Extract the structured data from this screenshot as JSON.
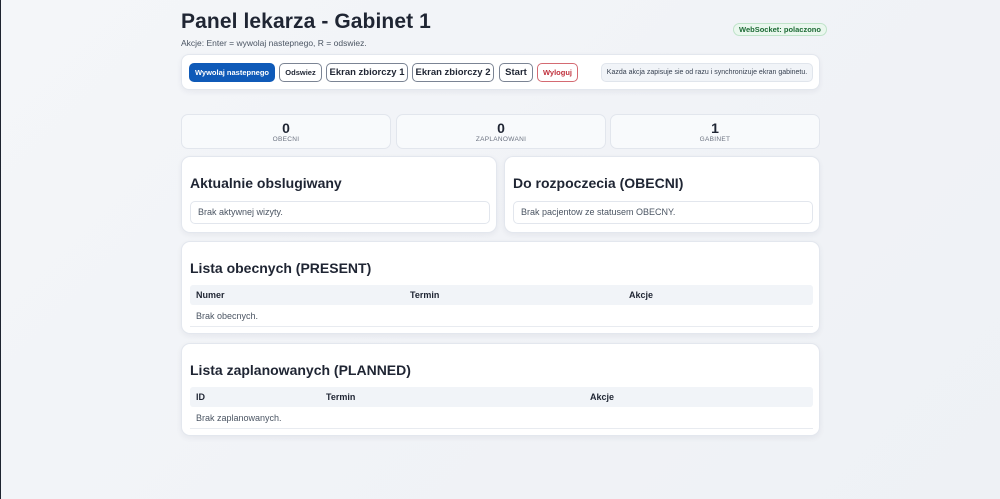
{
  "header": {
    "title": "Panel lekarza - Gabinet 1",
    "hint": "Akcje: Enter = wywolaj nastepnego, R = odswiez.",
    "ws_status": "WebSocket: polaczono"
  },
  "toolbar": {
    "call_next": "Wywolaj nastepnego",
    "refresh": "Odswiez",
    "screen1": "Ekran zbiorczy 1",
    "screen2": "Ekran zbiorczy 2",
    "start": "Start",
    "logout": "Wyloguj",
    "note": "Kazda akcja zapisuje sie od razu i synchronizuje ekran gabinetu."
  },
  "stats": [
    {
      "value": "0",
      "label": "OBECNI"
    },
    {
      "value": "0",
      "label": "ZAPLANOWANI"
    },
    {
      "value": "1",
      "label": "GABINET"
    }
  ],
  "current": {
    "title": "Aktualnie obslugiwany",
    "empty": "Brak aktywnej wizyty."
  },
  "queue": {
    "title": "Do rozpoczecia (OBECNI)",
    "empty": "Brak pacjentow ze statusem OBECNY."
  },
  "present_list": {
    "title": "Lista obecnych (PRESENT)",
    "columns": [
      "Numer",
      "Termin",
      "Akcje"
    ],
    "empty": "Brak obecnych."
  },
  "planned_list": {
    "title": "Lista zaplanowanych (PLANNED)",
    "columns": [
      "ID",
      "Termin",
      "Akcje"
    ],
    "empty": "Brak zaplanowanych."
  }
}
